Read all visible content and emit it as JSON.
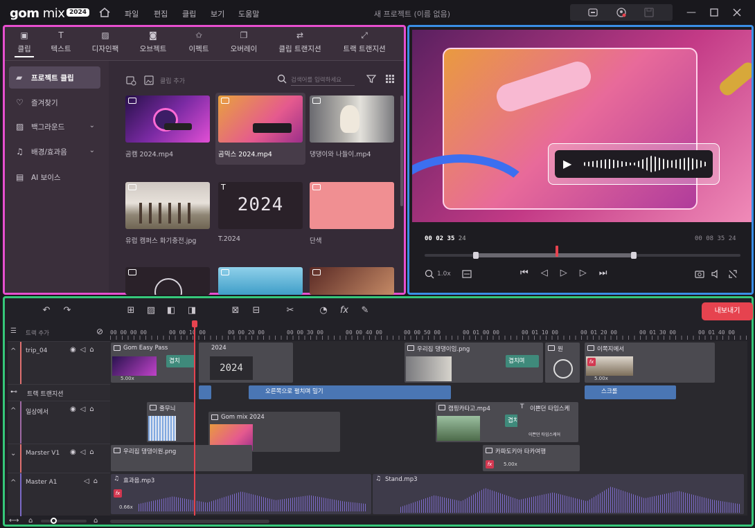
{
  "titlebar": {
    "logo": "gom mix",
    "logo_bold": "gom",
    "logo_rest": " mix",
    "logo_badge": "2024",
    "menu": [
      "파일",
      "편집",
      "클립",
      "보기",
      "도움말"
    ],
    "project_title": "새 프로젝트 (이름 없음)"
  },
  "media": {
    "tabs": [
      "클립",
      "텍스트",
      "디자인팩",
      "오브젝트",
      "이펙트",
      "오버레이",
      "클립 트랜지션",
      "트랙 트랜지션"
    ],
    "sidebar": [
      {
        "label": "프로젝트 클립",
        "icon": "folder-icon"
      },
      {
        "label": "즐겨찾기",
        "icon": "heart-icon"
      },
      {
        "label": "백그라운드",
        "icon": "background-icon"
      },
      {
        "label": "배경/효과음",
        "icon": "music-note-icon"
      },
      {
        "label": "AI 보이스",
        "icon": "ai-voice-icon"
      }
    ],
    "add_clip": "클립 추가",
    "search_placeholder": "검색어를 입력하세요",
    "clips": [
      {
        "name": "곰캠 2024.mp4"
      },
      {
        "name": "곰믹스 2024.mp4"
      },
      {
        "name": "댕댕이와 나들이.mp4"
      },
      {
        "name": "유럽 캠퍼스 화기충전.jpg"
      },
      {
        "name": "T.2024",
        "text": "2024"
      },
      {
        "name": "단색"
      }
    ]
  },
  "preview": {
    "current_time": [
      "00",
      "02",
      "35",
      "24"
    ],
    "total_time": "00 08 35 24",
    "zoom": "1.0x",
    "progress": 0.04
  },
  "timeline": {
    "export_label": "내보내기",
    "add_track_label": "트랙 추가",
    "ruler": [
      "00 00 00 00",
      "00 00 10 00",
      "00 00 20 00",
      "00 00 30 00",
      "00 00 40 00",
      "00 00 50 00",
      "00 01 00 00",
      "00 01 10 00",
      "00 01 20 00",
      "00 01 30 00",
      "00 01 40 00"
    ],
    "tracks": [
      {
        "name": "trip_04"
      },
      {
        "name": "트랙 트랜지션"
      },
      {
        "name": "일상에서"
      },
      {
        "name": "Marster V1"
      },
      {
        "name": "Master A1"
      }
    ],
    "clips": {
      "gom_easy_pass": "Gom Easy Pass",
      "speed_1": "5.00x",
      "t2024": "2024",
      "t2024_text": "2024",
      "dog_png": "우리집 댕댕이임.png",
      "circle": "원",
      "image_here": "이쪽지에서",
      "speed_2": "5.00x",
      "trans_a": "겹치",
      "trans_b": "겹치며",
      "trans_c": "겹치",
      "track_trans_1": "오른쪽으로 펼치며 밀기",
      "track_trans_2": "스크롤",
      "stripes": "줄무늬",
      "gom_mix_2024": "Gom mix 2024",
      "camping": "캠핑카타고.mp4",
      "typewriter": "이쁜던 타임스케",
      "typewriter_sub": "이쁜던 타임스케어",
      "dog_png_2": "우리집 댕댕이원.png",
      "kappadokia": "카파도키아 타카여행",
      "speed_3": "5.00x",
      "effect_mp3": "효과음.mp3",
      "audio_speed": "0.66x",
      "stand_mp3": "Stand.mp3"
    }
  },
  "colors": {
    "media_border": "#e74fcf",
    "preview_border": "#3a8fe6",
    "timeline_border": "#36c87a",
    "export": "#e6434f",
    "playhead": "#e6434f"
  }
}
